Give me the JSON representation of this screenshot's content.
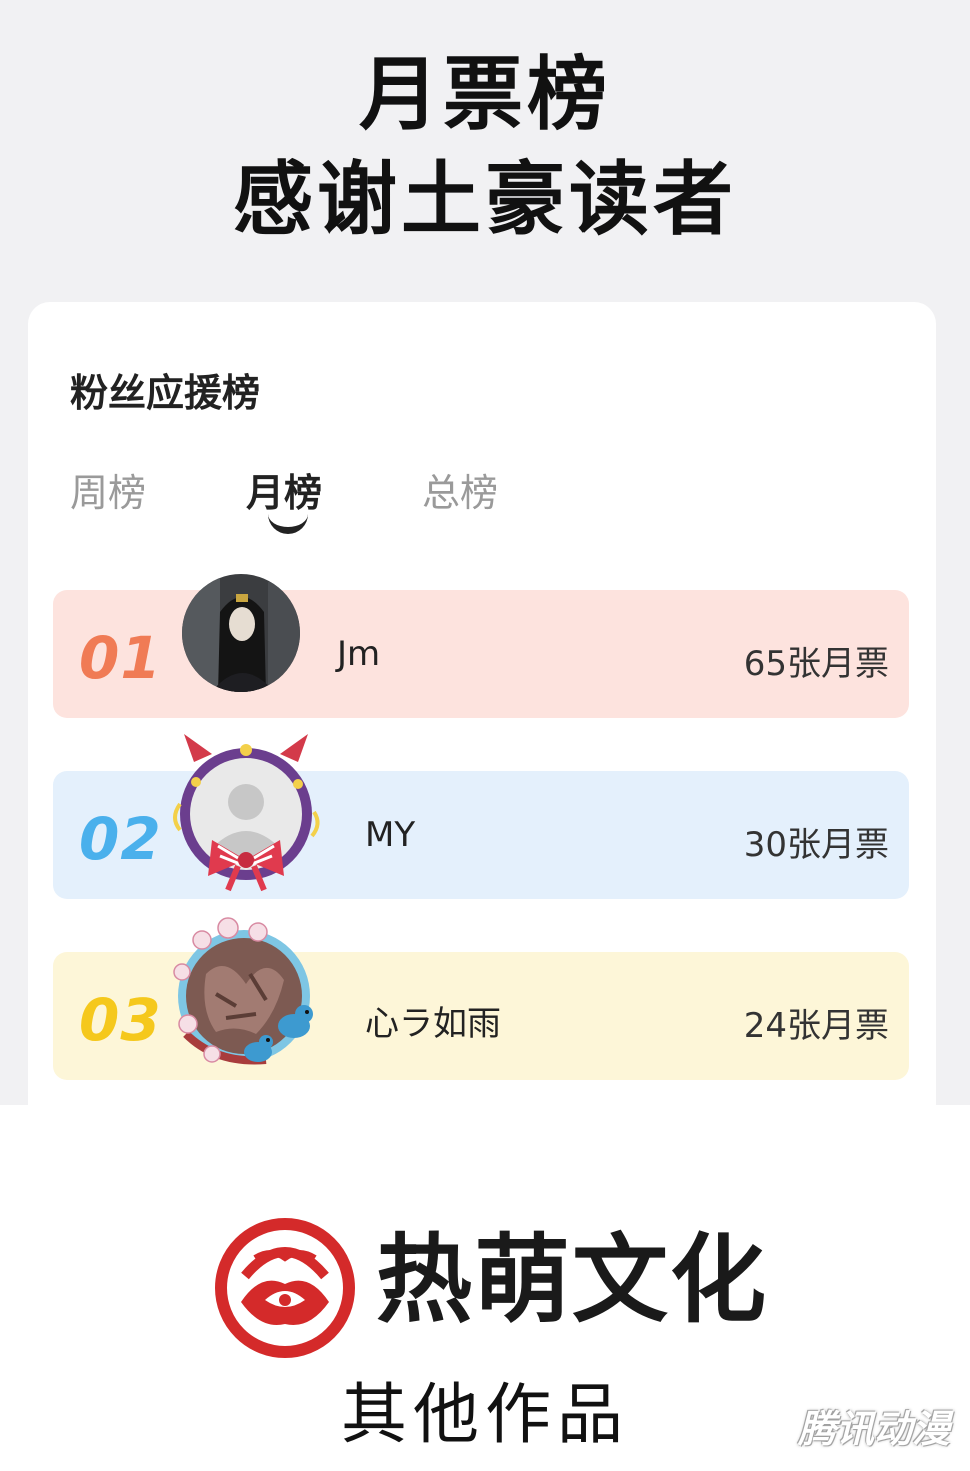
{
  "header": {
    "line1": "月票榜",
    "line2": "感谢土豪读者"
  },
  "card": {
    "title": "粉丝应援榜",
    "tabs": [
      {
        "label": "周榜",
        "active": false
      },
      {
        "label": "月榜",
        "active": true
      },
      {
        "label": "总榜",
        "active": false
      }
    ]
  },
  "ranking": [
    {
      "rank": "01",
      "name": "Jm",
      "votes": "65张月票",
      "row_color": "#fde3de",
      "rank_color": "#f07b55",
      "avatar": "dark-portrait-avatar"
    },
    {
      "rank": "02",
      "name": "MY",
      "votes": "30张月票",
      "row_color": "#e4f0fc",
      "rank_color": "#4ab0ec",
      "avatar": "default-avatar-devil-frame"
    },
    {
      "rank": "03",
      "name": "心ラ如雨",
      "votes": "24张月票",
      "row_color": "#fdf6d8",
      "rank_color": "#f5c81c",
      "avatar": "blossom-frame-avatar"
    }
  ],
  "footer": {
    "brand": "热萌文化",
    "other_works": "其他作品",
    "watermark": "腾讯动漫",
    "brand_color": "#d42a2a"
  }
}
